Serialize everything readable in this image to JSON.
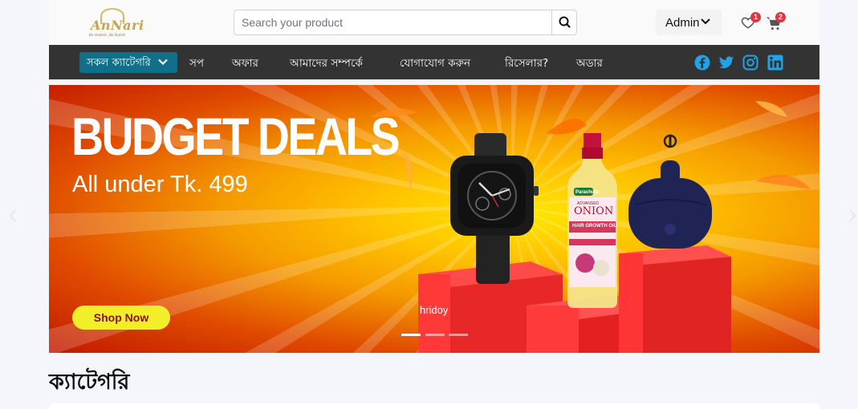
{
  "header": {
    "logo": {
      "text": "AnNari",
      "tagline": "Be modest...Be Stylish"
    },
    "search": {
      "placeholder": "Search your product",
      "value": ""
    },
    "user": {
      "label": "Admin"
    },
    "wishlist": {
      "count": "1"
    },
    "cart": {
      "count": "2"
    }
  },
  "nav": {
    "categories_button": "সকল ক্যাটেগরি",
    "links": [
      "সপ",
      "অফার",
      "আমাদের সম্পর্কে",
      "যোগাযোগ করুন",
      "রিসেলার?",
      "অডার"
    ],
    "social": [
      "facebook-icon",
      "twitter-icon",
      "instagram-icon",
      "linkedin-icon"
    ],
    "social_color": "#1fa3e8"
  },
  "banner": {
    "headline": "BUDGET DEALS",
    "subline": "All under Tk. 499",
    "button": "Shop Now",
    "caption": "hridoy",
    "slides": 3,
    "active_slide": 1,
    "products": {
      "bottle_brand": "Parachute",
      "bottle_sub": "ADVANSED",
      "bottle_name": "ONION",
      "bottle_detail": "HAIR GROWTH OIL"
    }
  },
  "section": {
    "title": "ক্যাটেগরি"
  },
  "colors": {
    "nav_bg": "#333333",
    "accent": "#10708a",
    "badge": "#e03540",
    "cta": "#f2ef2a"
  }
}
